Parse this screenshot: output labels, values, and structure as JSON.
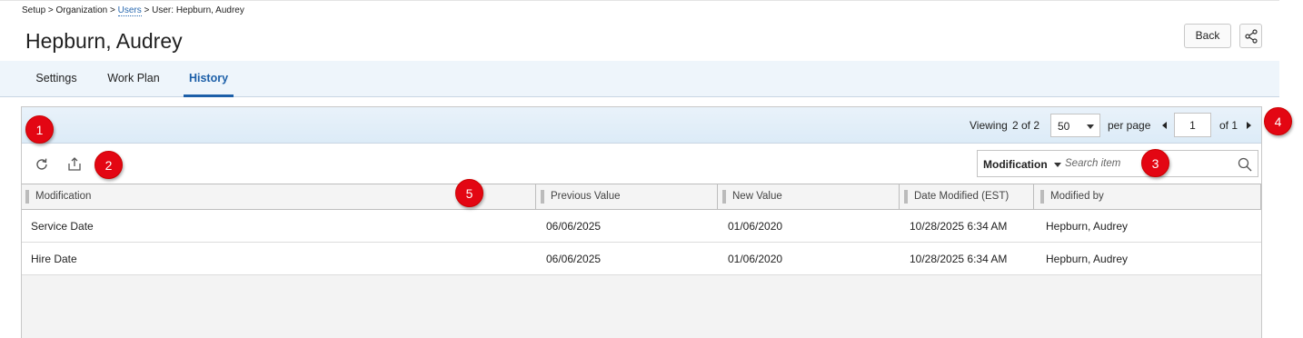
{
  "breadcrumb": {
    "part1": "Setup > Organization > ",
    "link": "Users",
    "part2": " > User: Hepburn, Audrey"
  },
  "page": {
    "title": "Hepburn, Audrey"
  },
  "header_actions": {
    "back_label": "Back",
    "share_icon": "share-icon"
  },
  "tabs": [
    {
      "label": "Settings",
      "active": false
    },
    {
      "label": "Work Plan",
      "active": false
    },
    {
      "label": "History",
      "active": true
    }
  ],
  "pager": {
    "viewing_label": "Viewing",
    "count_text": "2 of 2",
    "page_size": "50",
    "per_page_label": "per page",
    "current_page": "1",
    "of_label": "of 1"
  },
  "toolbar": {
    "refresh_icon": "refresh-icon",
    "export_icon": "export-icon"
  },
  "search": {
    "field_label": "Modification",
    "placeholder": "Search item",
    "icon": "magnifier-icon"
  },
  "grid": {
    "columns": [
      "Modification",
      "Previous Value",
      "New Value",
      "Date Modified (EST)",
      "Modified by"
    ],
    "rows": [
      [
        "Service Date",
        "06/06/2025",
        "01/06/2020",
        "10/28/2025 6:34 AM",
        "Hepburn, Audrey"
      ],
      [
        "Hire Date",
        "06/06/2025",
        "01/06/2020",
        "10/28/2025 6:34 AM",
        "Hepburn, Audrey"
      ]
    ]
  },
  "markers": [
    "1",
    "2",
    "3",
    "4",
    "5"
  ],
  "colors": {
    "accent": "#1c5fa8",
    "link": "#2a6ab0",
    "marker": "#e30613",
    "tab_bar": "#eef5fb"
  }
}
